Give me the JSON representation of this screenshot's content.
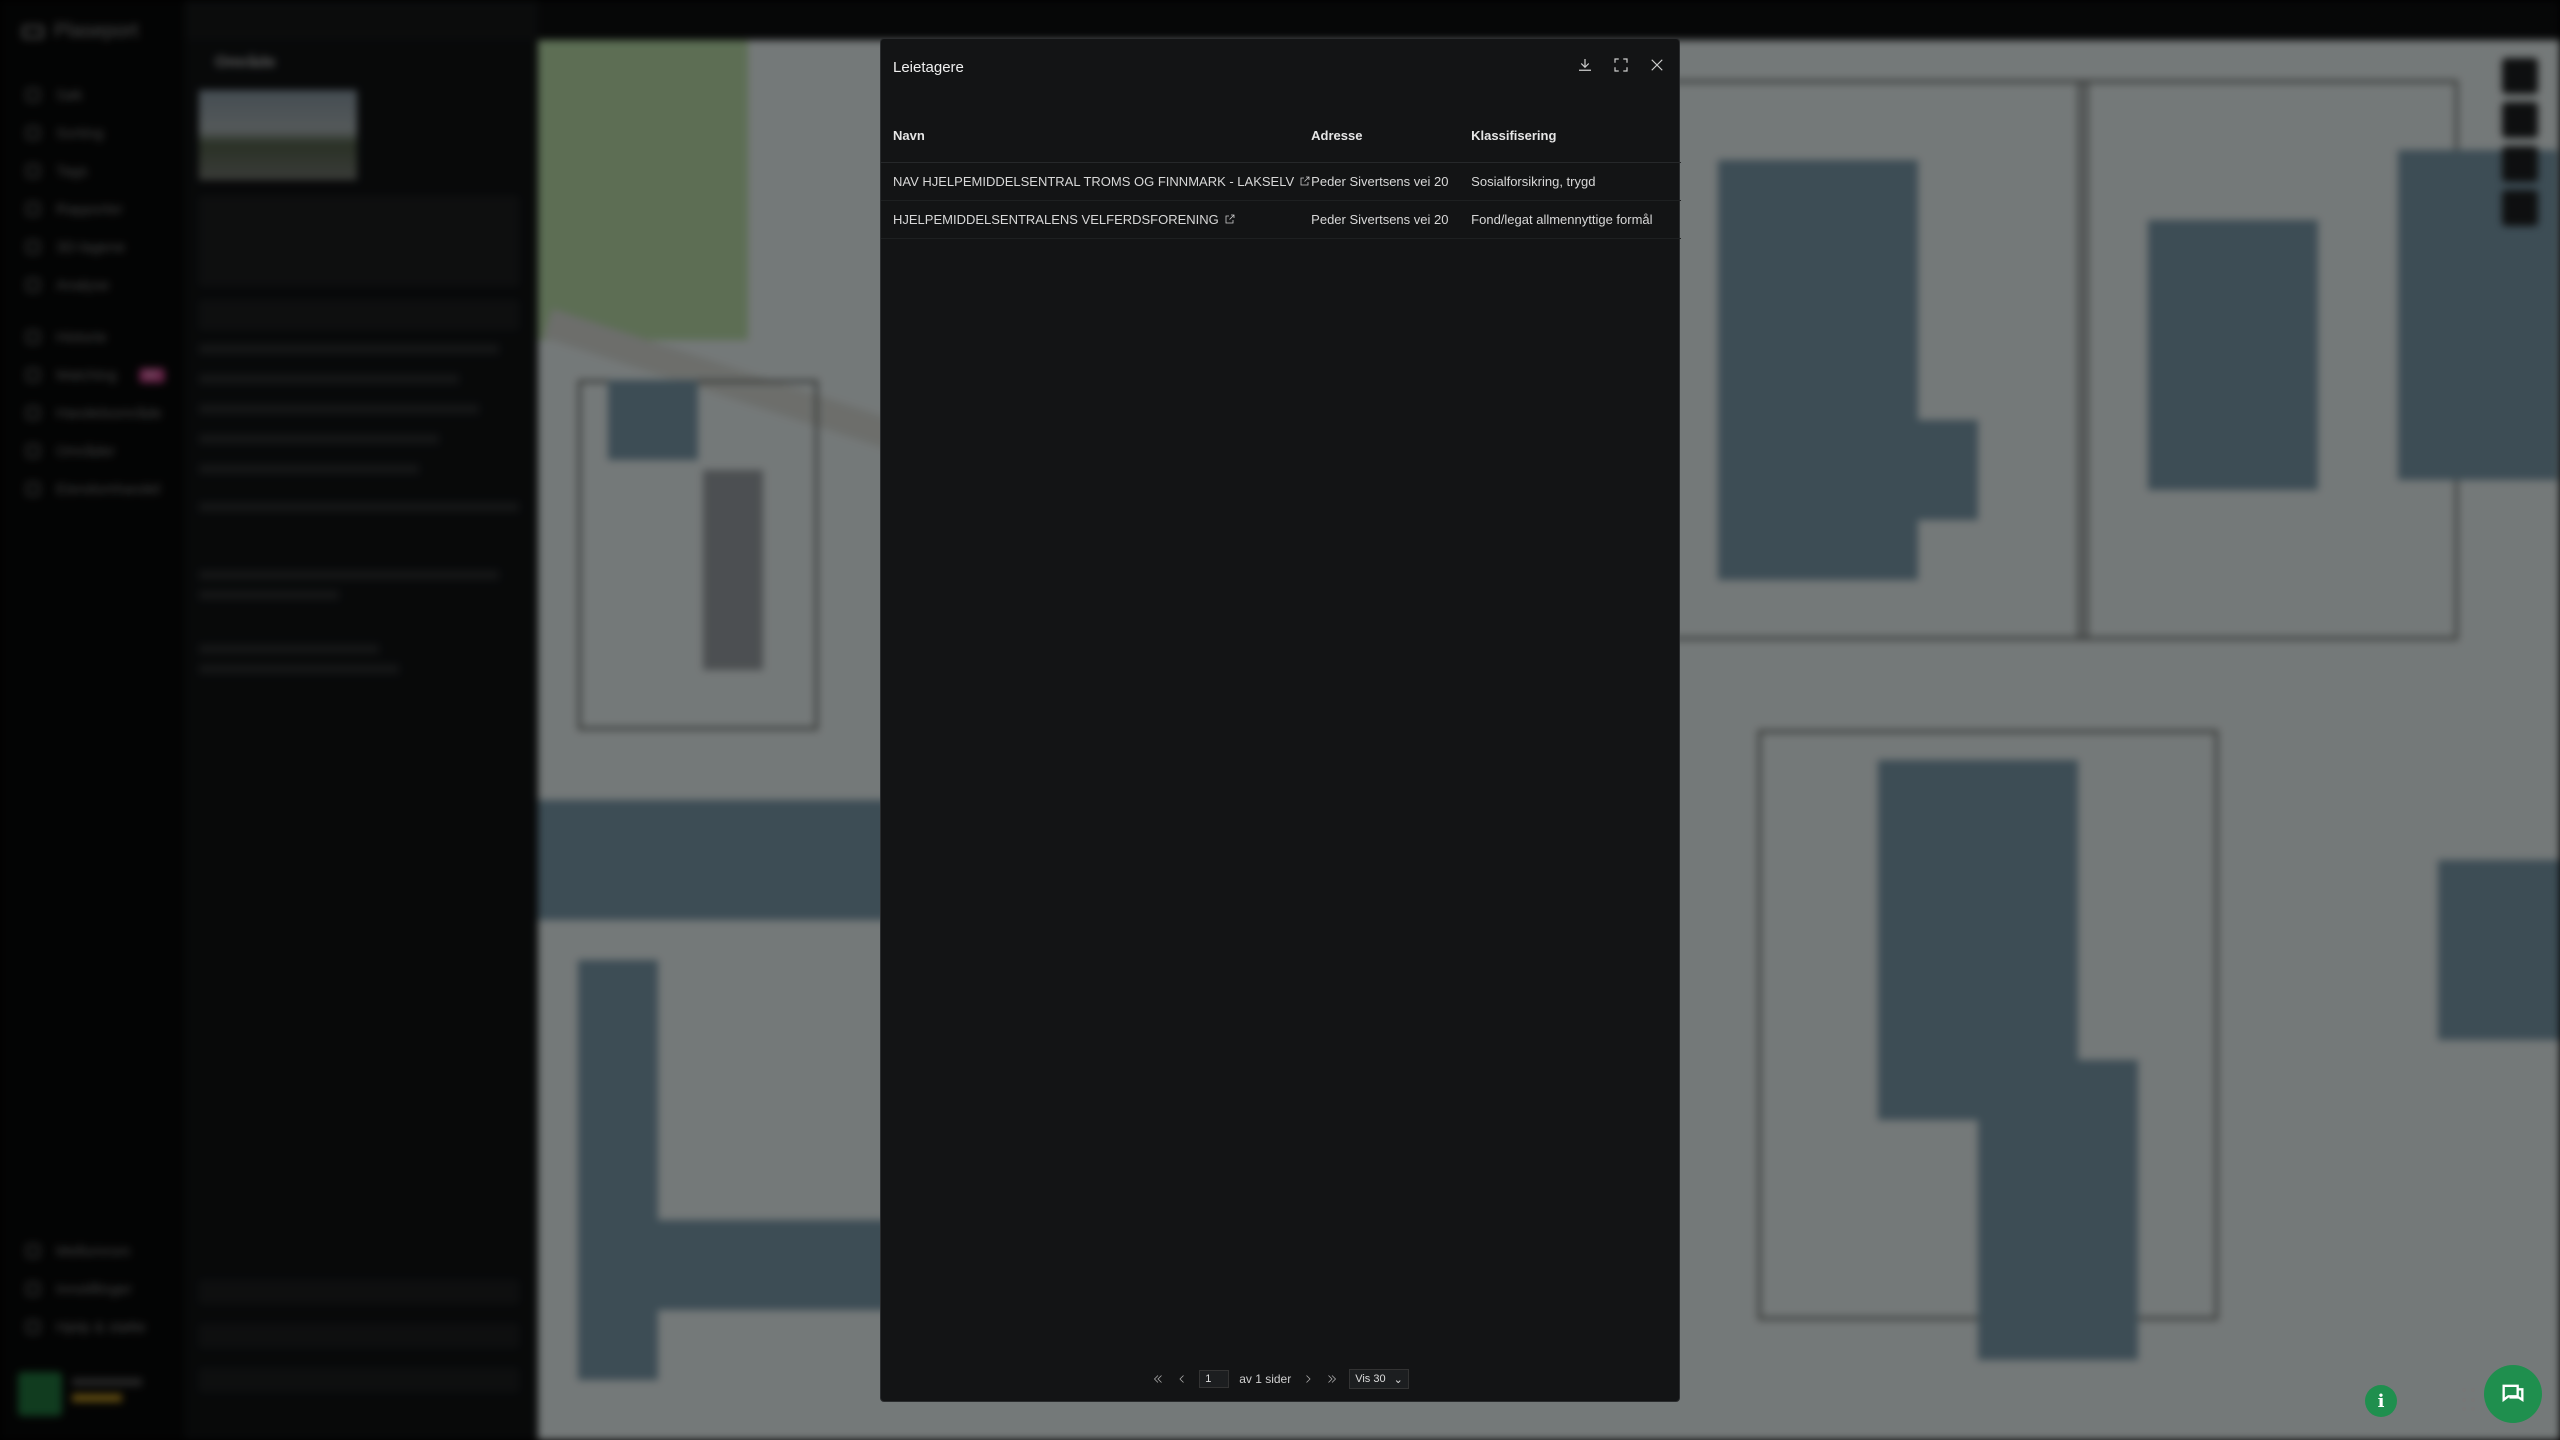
{
  "app": {
    "brand": "Plaseport"
  },
  "sidebar": {
    "items": [
      {
        "label": "Søk"
      },
      {
        "label": "Sorting"
      },
      {
        "label": "Tags"
      },
      {
        "label": "Rapporter"
      },
      {
        "label": "3D-lagene"
      },
      {
        "label": "Analyse"
      },
      {
        "label": "Historie"
      },
      {
        "label": "Matching",
        "badge": "NY"
      },
      {
        "label": "Handelsområde"
      },
      {
        "label": "Områder"
      },
      {
        "label": "Eiendomhandel"
      }
    ],
    "bottom_items": [
      {
        "label": "Mellomrom"
      },
      {
        "label": "Innstillinger"
      },
      {
        "label": "Hjelp & støtte"
      }
    ]
  },
  "panel": {
    "title": "Område"
  },
  "modal": {
    "title": "Leietagere",
    "columns": {
      "name": "Navn",
      "address": "Adresse",
      "classification": "Klassifisering"
    },
    "rows": [
      {
        "name": "NAV HJELPEMIDDELSENTRAL TROMS OG FINNMARK - LAKSELV",
        "address": "Peder Sivertsens vei 20",
        "classification": "Sosialforsikring, trygd"
      },
      {
        "name": "HJELPEMIDDELSENTRALENS VELFERDSFORENING",
        "address": "Peder Sivertsens vei 20",
        "classification": "Fond/legat allmennyttige formål"
      }
    ],
    "pagination": {
      "current_page": "1",
      "of_pages_text": "av 1 sider",
      "page_size_label": "Vis 30"
    }
  },
  "floating": {
    "info_label": "i"
  },
  "colors": {
    "accent": "#1f8f4e",
    "modal_bg": "#131415",
    "map_water_blue": "#6f8c9b"
  }
}
